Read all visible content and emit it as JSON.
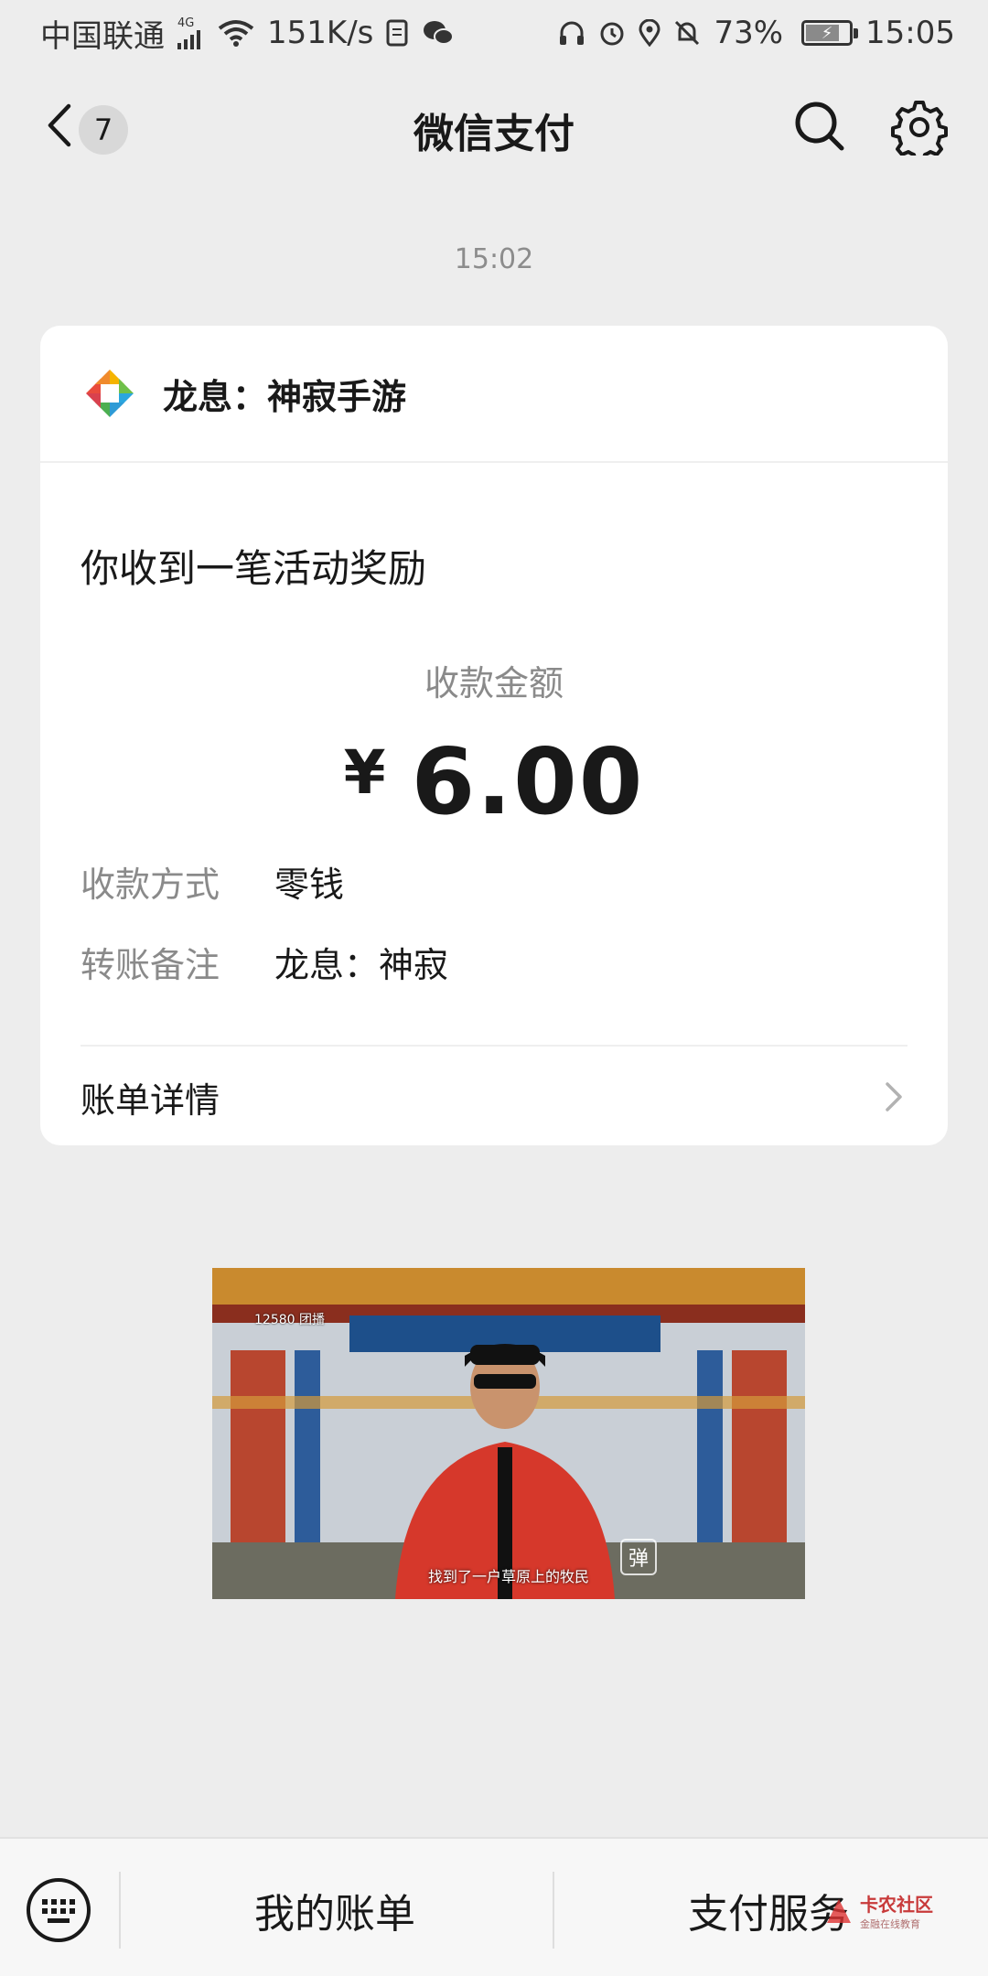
{
  "status_bar": {
    "carrier": "中国联通",
    "network": "4G",
    "speed": "151K/s",
    "battery": "73%",
    "time": "15:05"
  },
  "nav": {
    "badge_count": "7",
    "title": "微信支付"
  },
  "timestamp": "15:02",
  "card": {
    "merchant_name": "龙息：神寂手游",
    "heading": "你收到一笔活动奖励",
    "amount_label": "收款金额",
    "currency_symbol": "¥",
    "amount": "6.00",
    "details": [
      {
        "key": "收款方式",
        "value": "零钱"
      },
      {
        "key": "转账备注",
        "value": "龙息：神寂"
      }
    ],
    "bill_link": "账单详情"
  },
  "ad": {
    "caption": "找到了一户草原上的牧民",
    "overlay_text": "12580 团播",
    "danmu_label": "弹"
  },
  "bottom_bar": {
    "my_bill": "我的账单",
    "pay_service": "支付服务"
  },
  "watermark": {
    "title": "卡农社区",
    "subtitle": "金融在线教育"
  }
}
